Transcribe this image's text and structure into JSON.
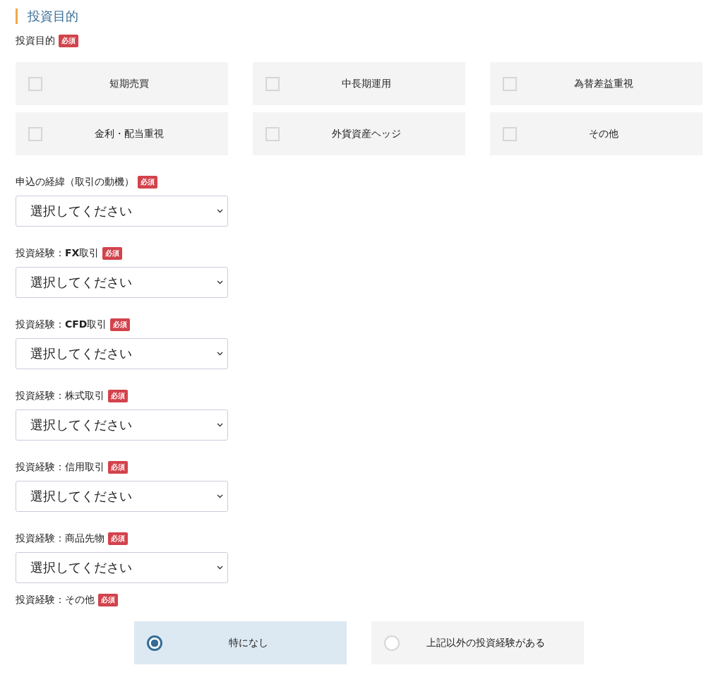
{
  "section_title": "投資目的",
  "purpose": {
    "label": "投資目的",
    "badge": "必須",
    "options": [
      {
        "label": "短期売買",
        "checked": false
      },
      {
        "label": "中長期運用",
        "checked": false
      },
      {
        "label": "為替差益重視",
        "checked": false
      },
      {
        "label": "金利・配当重視",
        "checked": false
      },
      {
        "label": "外貨資産ヘッジ",
        "checked": false
      },
      {
        "label": "その他",
        "checked": false
      }
    ]
  },
  "selects": [
    {
      "label": "申込の経緯（取引の動機）",
      "badge": "必須",
      "value": "選択してください"
    },
    {
      "label": "投資経験：**FX**取引",
      "badge": "必須",
      "value": "選択してください"
    },
    {
      "label": "投資経験：**CFD**取引",
      "badge": "必須",
      "value": "選択してください"
    },
    {
      "label": "投資経験：株式取引",
      "badge": "必須",
      "value": "選択してください"
    },
    {
      "label": "投資経験：信用取引",
      "badge": "必須",
      "value": "選択してください"
    },
    {
      "label": "投資経験：商品先物",
      "badge": "必須",
      "value": "選択してください"
    }
  ],
  "other_experience": {
    "label": "投資経験：その他",
    "badge": "必須",
    "options": [
      {
        "label": "特になし",
        "selected": true
      },
      {
        "label": "上記以外の投資経験がある",
        "selected": false
      }
    ]
  }
}
